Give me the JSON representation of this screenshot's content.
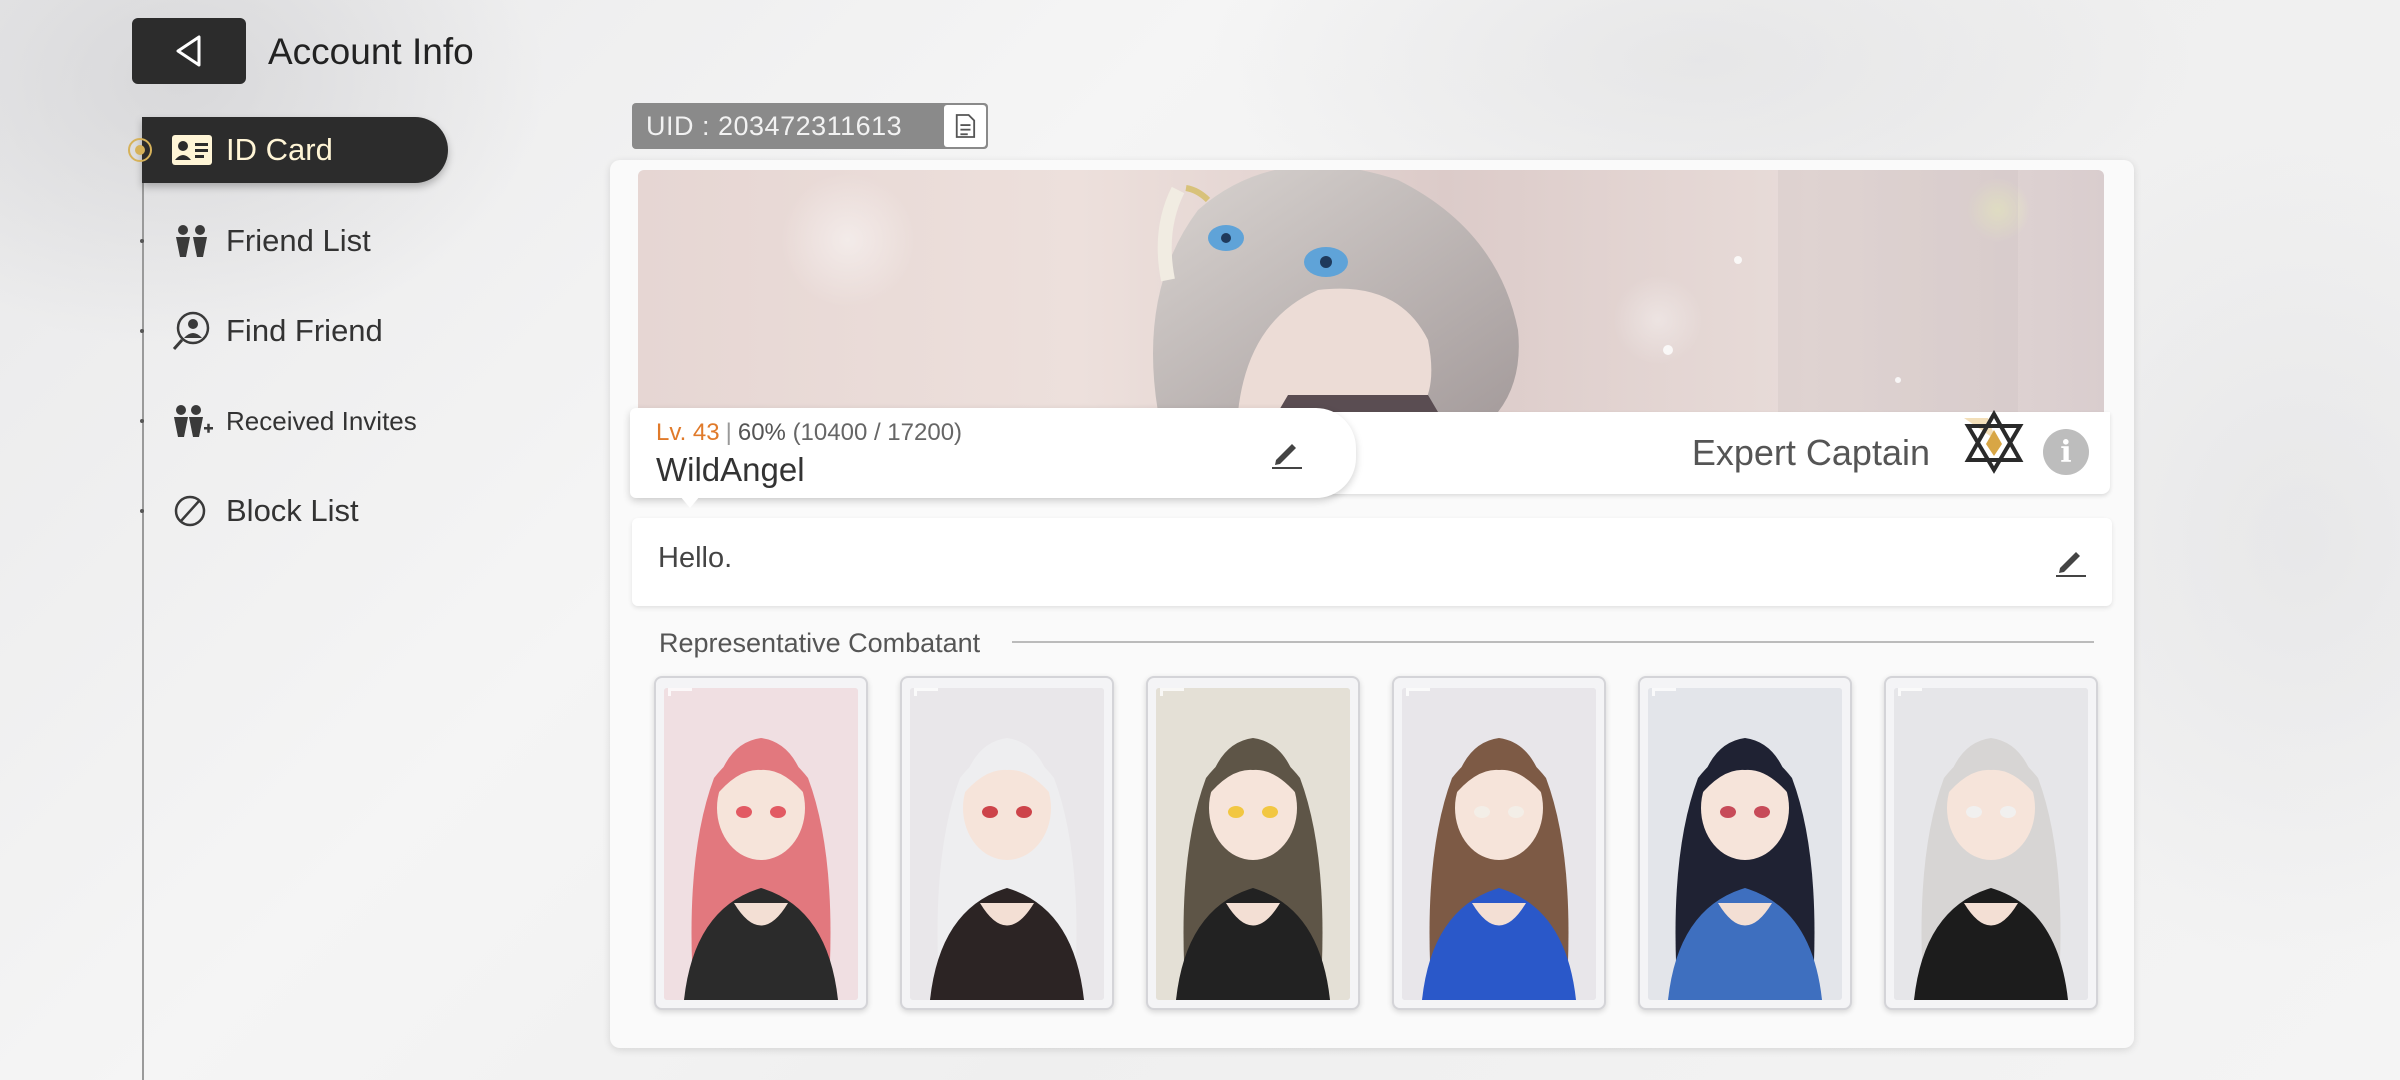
{
  "header": {
    "title": "Account Info"
  },
  "sidebar": {
    "items": [
      {
        "label": "ID Card",
        "icon": "id-card-icon",
        "active": true
      },
      {
        "label": "Friend List",
        "icon": "friends-icon",
        "active": false
      },
      {
        "label": "Find Friend",
        "icon": "find-friend-icon",
        "active": false
      },
      {
        "label": "Received Invites",
        "icon": "add-friend-icon",
        "active": false
      },
      {
        "label": "Block List",
        "icon": "block-icon",
        "active": false
      }
    ]
  },
  "profile": {
    "uid": "UID : 203472311613",
    "level": "Lv. 43",
    "exp_percent": "60%",
    "exp_detail": "(10400 / 17200)",
    "name": "WildAngel",
    "rank": "Expert Captain",
    "greeting": "Hello."
  },
  "representative": {
    "title": "Representative Combatant",
    "combatants": [
      {
        "hair": "#e2787e",
        "outfit": "#2b2b2b",
        "accent": "#e04a55",
        "bg": "#f0dfe2"
      },
      {
        "hair": "#eeeef0",
        "outfit": "#2c2424",
        "accent": "#c9323a",
        "bg": "#e9e7ea"
      },
      {
        "hair": "#5e5547",
        "outfit": "#222222",
        "accent": "#f2c331",
        "bg": "#e4e0d6"
      },
      {
        "hair": "#7d5a45",
        "outfit": "#2a58c9",
        "accent": "#f3eee8",
        "bg": "#e8e6ea"
      },
      {
        "hair": "#1f2233",
        "outfit": "#3e6fbf",
        "accent": "#c23a4a",
        "bg": "#e3e5ea"
      },
      {
        "hair": "#d7d5d4",
        "outfit": "#1c1c1c",
        "accent": "#f1f1f1",
        "bg": "#e6e6e9"
      }
    ]
  },
  "colors": {
    "accent_orange": "#e07a2a",
    "active_bg": "#2c2c2c",
    "active_text": "#fff5d6"
  }
}
